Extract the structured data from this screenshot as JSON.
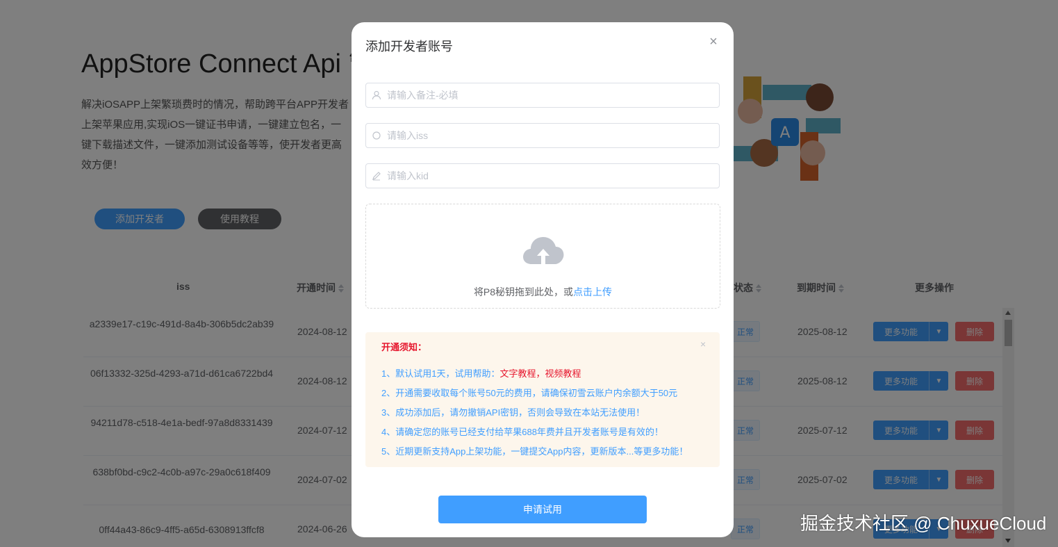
{
  "hero": {
    "title": "AppStore Connect Api 管理",
    "description": "解决iOSAPP上架繁琐费时的情况，帮助跨平台APP开发者\n上架苹果应用,实现iOS一键证书申请，一键建立包名，一\n键下载描述文件，一键添加测试设备等等，使开发者更高\n效方便！",
    "add_button": "添加开发者",
    "guide_button": "使用教程"
  },
  "table": {
    "headers": {
      "iss": "iss",
      "open_time": "开通时间",
      "status": "状态",
      "expire_time": "到期时间",
      "actions": "更多操作"
    },
    "rows": [
      {
        "iss": "a2339e17-c19c-491d-8a4b-306b5dc2ab39",
        "open_time": "2024-08-12",
        "status": "正常",
        "expire_time": "2025-08-12"
      },
      {
        "iss": "06f13332-325d-4293-a71d-d61ca6722bd4",
        "open_time": "2024-08-12",
        "status": "正常",
        "expire_time": "2025-08-12"
      },
      {
        "iss": "94211d78-c518-4e1a-bedf-97a8d8331439",
        "open_time": "2024-07-12",
        "status": "正常",
        "expire_time": "2025-07-12"
      },
      {
        "iss": "638bf0bd-c9c2-4c0b-a97c-29a0c618f409",
        "open_time": "2024-07-02",
        "status": "正常",
        "expire_time": "2025-07-02"
      },
      {
        "iss": "0ff44a43-86c9-4ff5-a65d-6308913ffcf8",
        "open_time": "2024-06-26",
        "status": "正常",
        "expire_time": ""
      }
    ],
    "more_label": "更多功能",
    "delete_label": "删除"
  },
  "dialog": {
    "title": "添加开发者账号",
    "fields": {
      "remark_placeholder": "请输入备注-必填",
      "iss_placeholder": "请输入iss",
      "kid_placeholder": "请输入kid"
    },
    "upload": {
      "text": "将P8秘钥拖到此处，或",
      "link": "点击上传"
    },
    "notice": {
      "title": "开通须知：",
      "item1_prefix": "1、默认试用1天，试用帮助：",
      "item1_link1": "文字教程",
      "item1_sep": "，",
      "item1_link2": "视频教程",
      "item2": "2、开通需要收取每个账号50元的费用，请确保初雪云账户内余额大于50元",
      "item3": "3、成功添加后，请勿撤销API密钥，否则会导致在本站无法使用！",
      "item4": "4、请确定您的账号已经支付给苹果688年费并且开发者账号是有效的！",
      "item5": "5、近期更新支持App上架功能，一键提交App内容，更新版本...等更多功能！"
    },
    "submit": "申请试用"
  },
  "watermark": "掘金技术社区 @ ChuxueCloud",
  "colors": {
    "primary": "#409eff",
    "danger": "#f56c6c",
    "notice_bg": "#fdf6ec",
    "notice_red": "#e6162d"
  }
}
